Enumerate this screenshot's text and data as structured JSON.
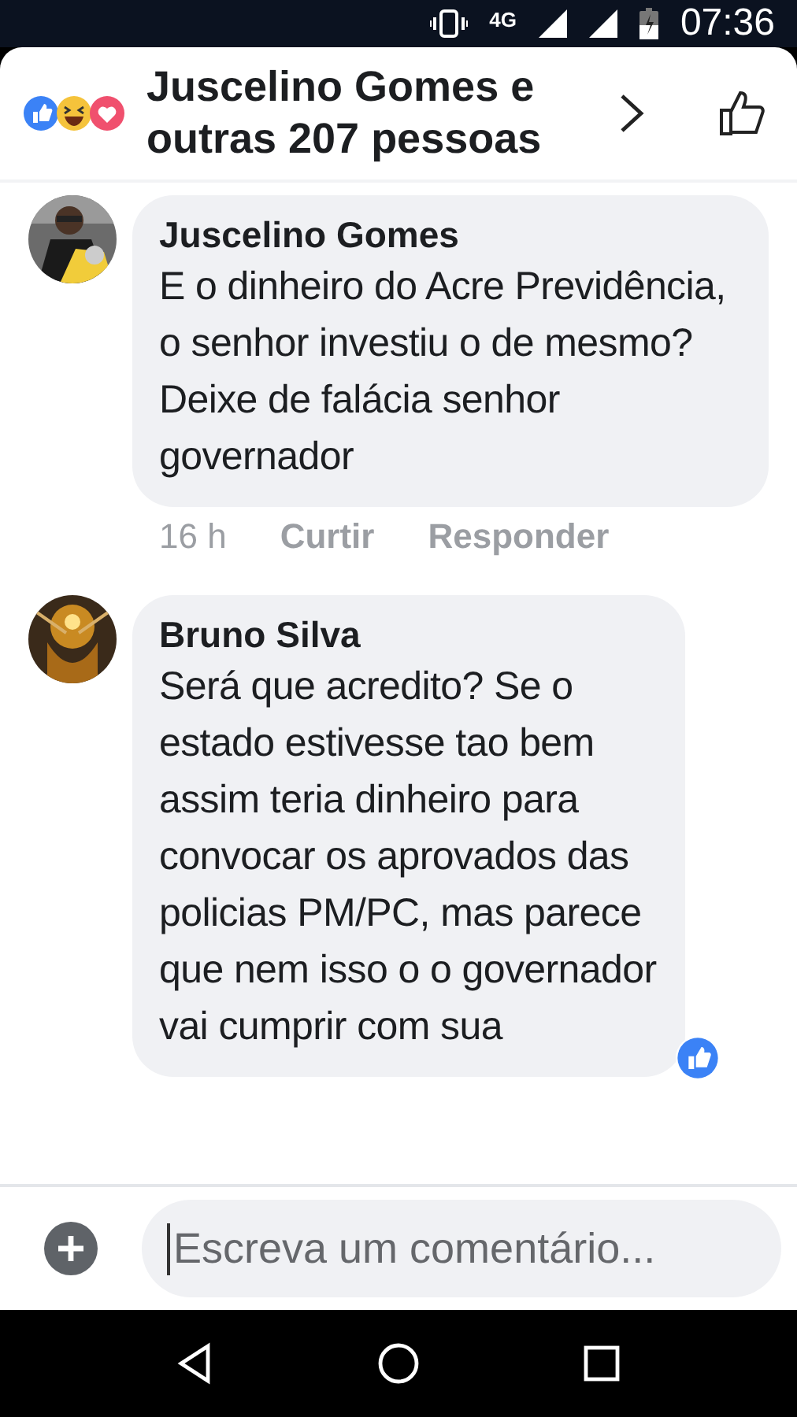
{
  "status_bar": {
    "network": "4G",
    "time": "07:36"
  },
  "header": {
    "title": "Juscelino Gomes e outras 207 pessoas",
    "reactions": [
      {
        "kind": "like"
      },
      {
        "kind": "haha"
      },
      {
        "kind": "love"
      }
    ]
  },
  "comments": [
    {
      "author": "Juscelino Gomes",
      "text": "E o dinheiro do Acre Previdência, o senhor investiu o de mesmo? Deixe de falácia senhor governador",
      "time": "16 h",
      "actions": [
        "Curtir",
        "Responder"
      ],
      "avatar": {
        "kind": "picture"
      }
    },
    {
      "author": "Bruno Silva",
      "text": "Será que acredito? Se o estado estivesse tao bem assim teria dinheiro para convocar os aprovados das policias PM/PC,  mas parece que nem isso o o governador vai cumprir com sua",
      "avatar": {
        "kind": "picture"
      },
      "reaction": {
        "kind": "like"
      }
    }
  ],
  "composer": {
    "placeholder": "Escreva um comentário..."
  }
}
